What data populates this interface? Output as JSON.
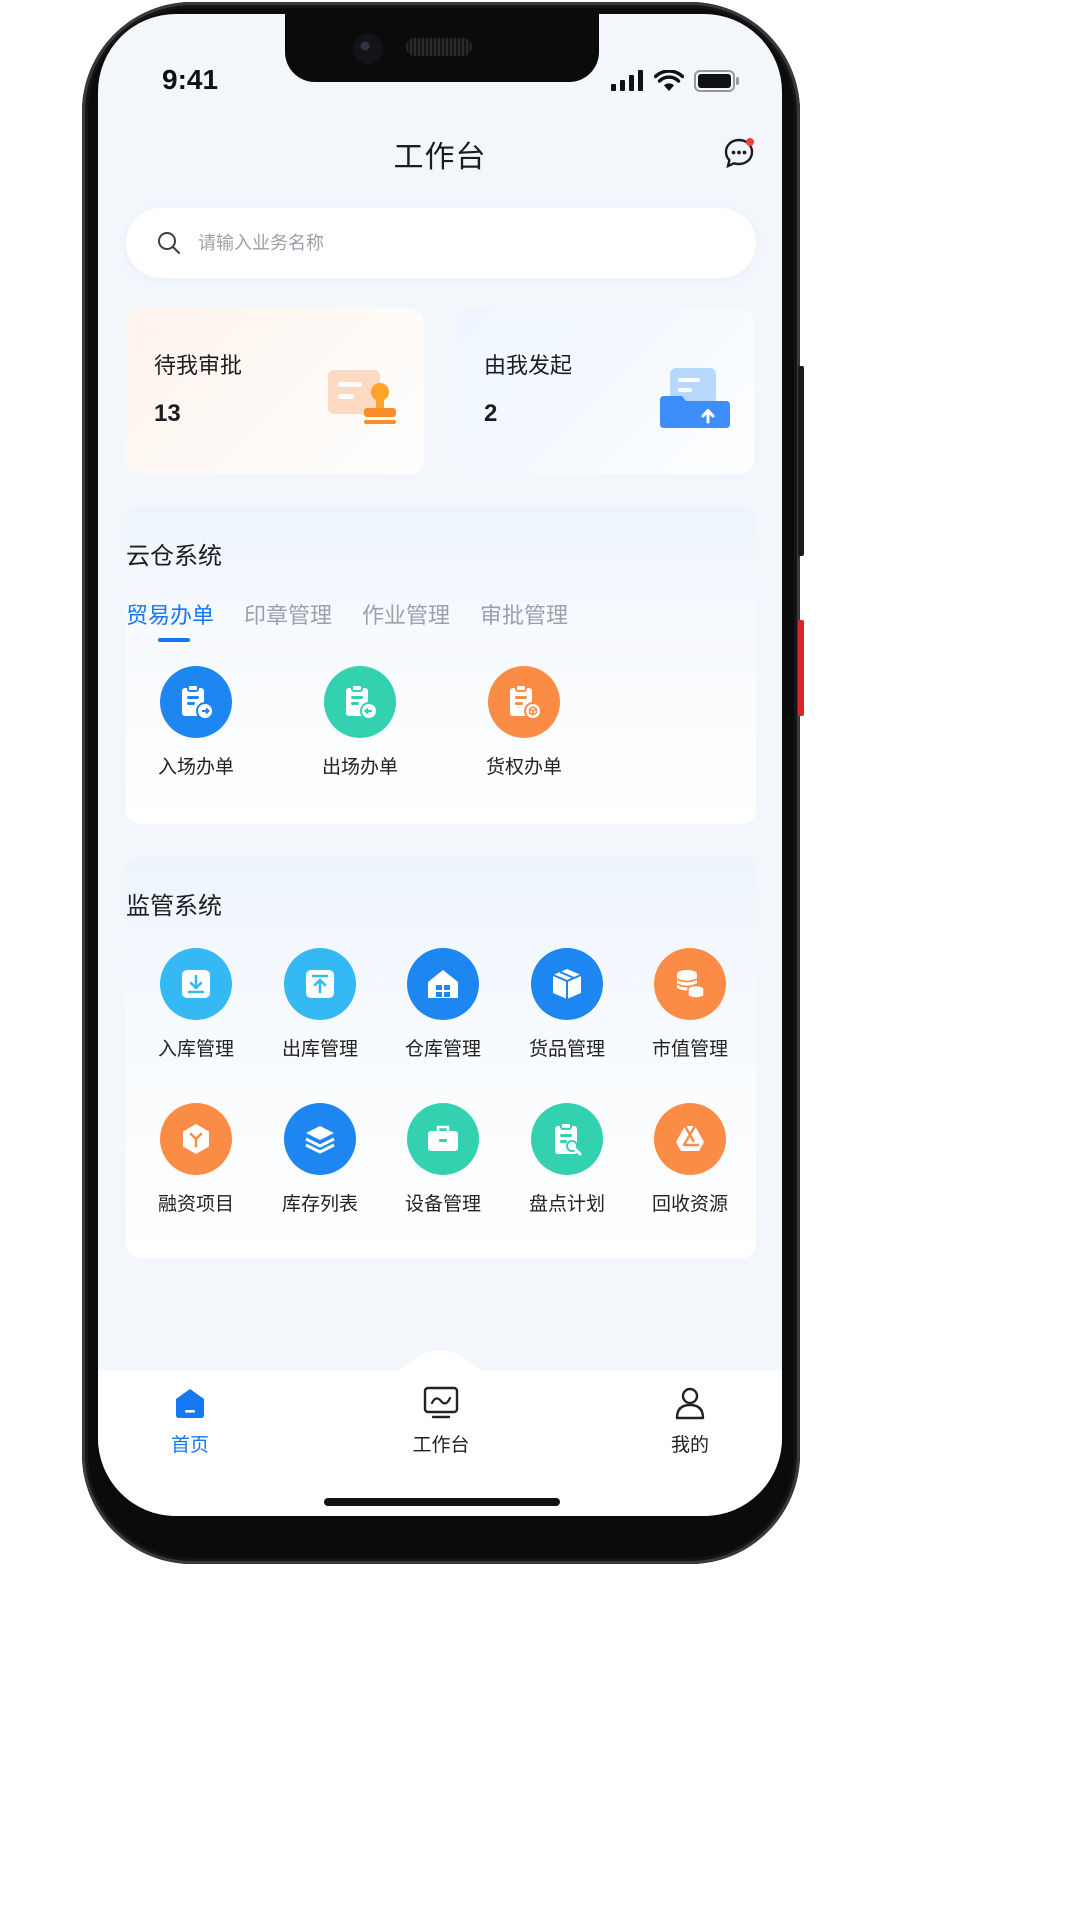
{
  "status_bar": {
    "time": "9:41"
  },
  "header": {
    "title": "工作台"
  },
  "search": {
    "placeholder": "请输入业务名称"
  },
  "summary_cards": [
    {
      "title": "待我审批",
      "count": "13"
    },
    {
      "title": "由我发起",
      "count": "2"
    }
  ],
  "cloud_warehouse": {
    "title": "云仓系统",
    "tabs": [
      "贸易办单",
      "印章管理",
      "作业管理",
      "审批管理"
    ],
    "active_tab": "贸易办单",
    "items": [
      {
        "label": "入场办单",
        "icon": "clipboard-in-icon",
        "color": "#1e86f0"
      },
      {
        "label": "出场办单",
        "icon": "clipboard-out-icon",
        "color": "#34d1b0"
      },
      {
        "label": "货权办单",
        "icon": "clipboard-cargo-icon",
        "color": "#fb8c45"
      }
    ]
  },
  "supervision": {
    "title": "监管系统",
    "items": [
      {
        "label": "入库管理",
        "icon": "inbound-icon",
        "color": "#35b9f5"
      },
      {
        "label": "出库管理",
        "icon": "outbound-icon",
        "color": "#35b9f5"
      },
      {
        "label": "仓库管理",
        "icon": "warehouse-icon",
        "color": "#1e86f0"
      },
      {
        "label": "货品管理",
        "icon": "package-icon",
        "color": "#1e86f0"
      },
      {
        "label": "市值管理",
        "icon": "coins-icon",
        "color": "#fb8c45"
      },
      {
        "label": "融资项目",
        "icon": "finance-cube-icon",
        "color": "#fb8c45"
      },
      {
        "label": "库存列表",
        "icon": "layers-icon",
        "color": "#1e86f0"
      },
      {
        "label": "设备管理",
        "icon": "toolbox-icon",
        "color": "#34d1b0"
      },
      {
        "label": "盘点计划",
        "icon": "inventory-check-icon",
        "color": "#34d1b0"
      },
      {
        "label": "回收资源",
        "icon": "recycle-icon",
        "color": "#fb8c45"
      }
    ]
  },
  "tab_bar": {
    "items": [
      {
        "label": "首页",
        "icon": "home-icon",
        "active": true
      },
      {
        "label": "工作台",
        "icon": "workbench-icon",
        "active": false
      },
      {
        "label": "我的",
        "icon": "user-icon",
        "active": false
      }
    ]
  },
  "colors": {
    "accent": "#1677f5",
    "notification_dot": "#f04141"
  }
}
